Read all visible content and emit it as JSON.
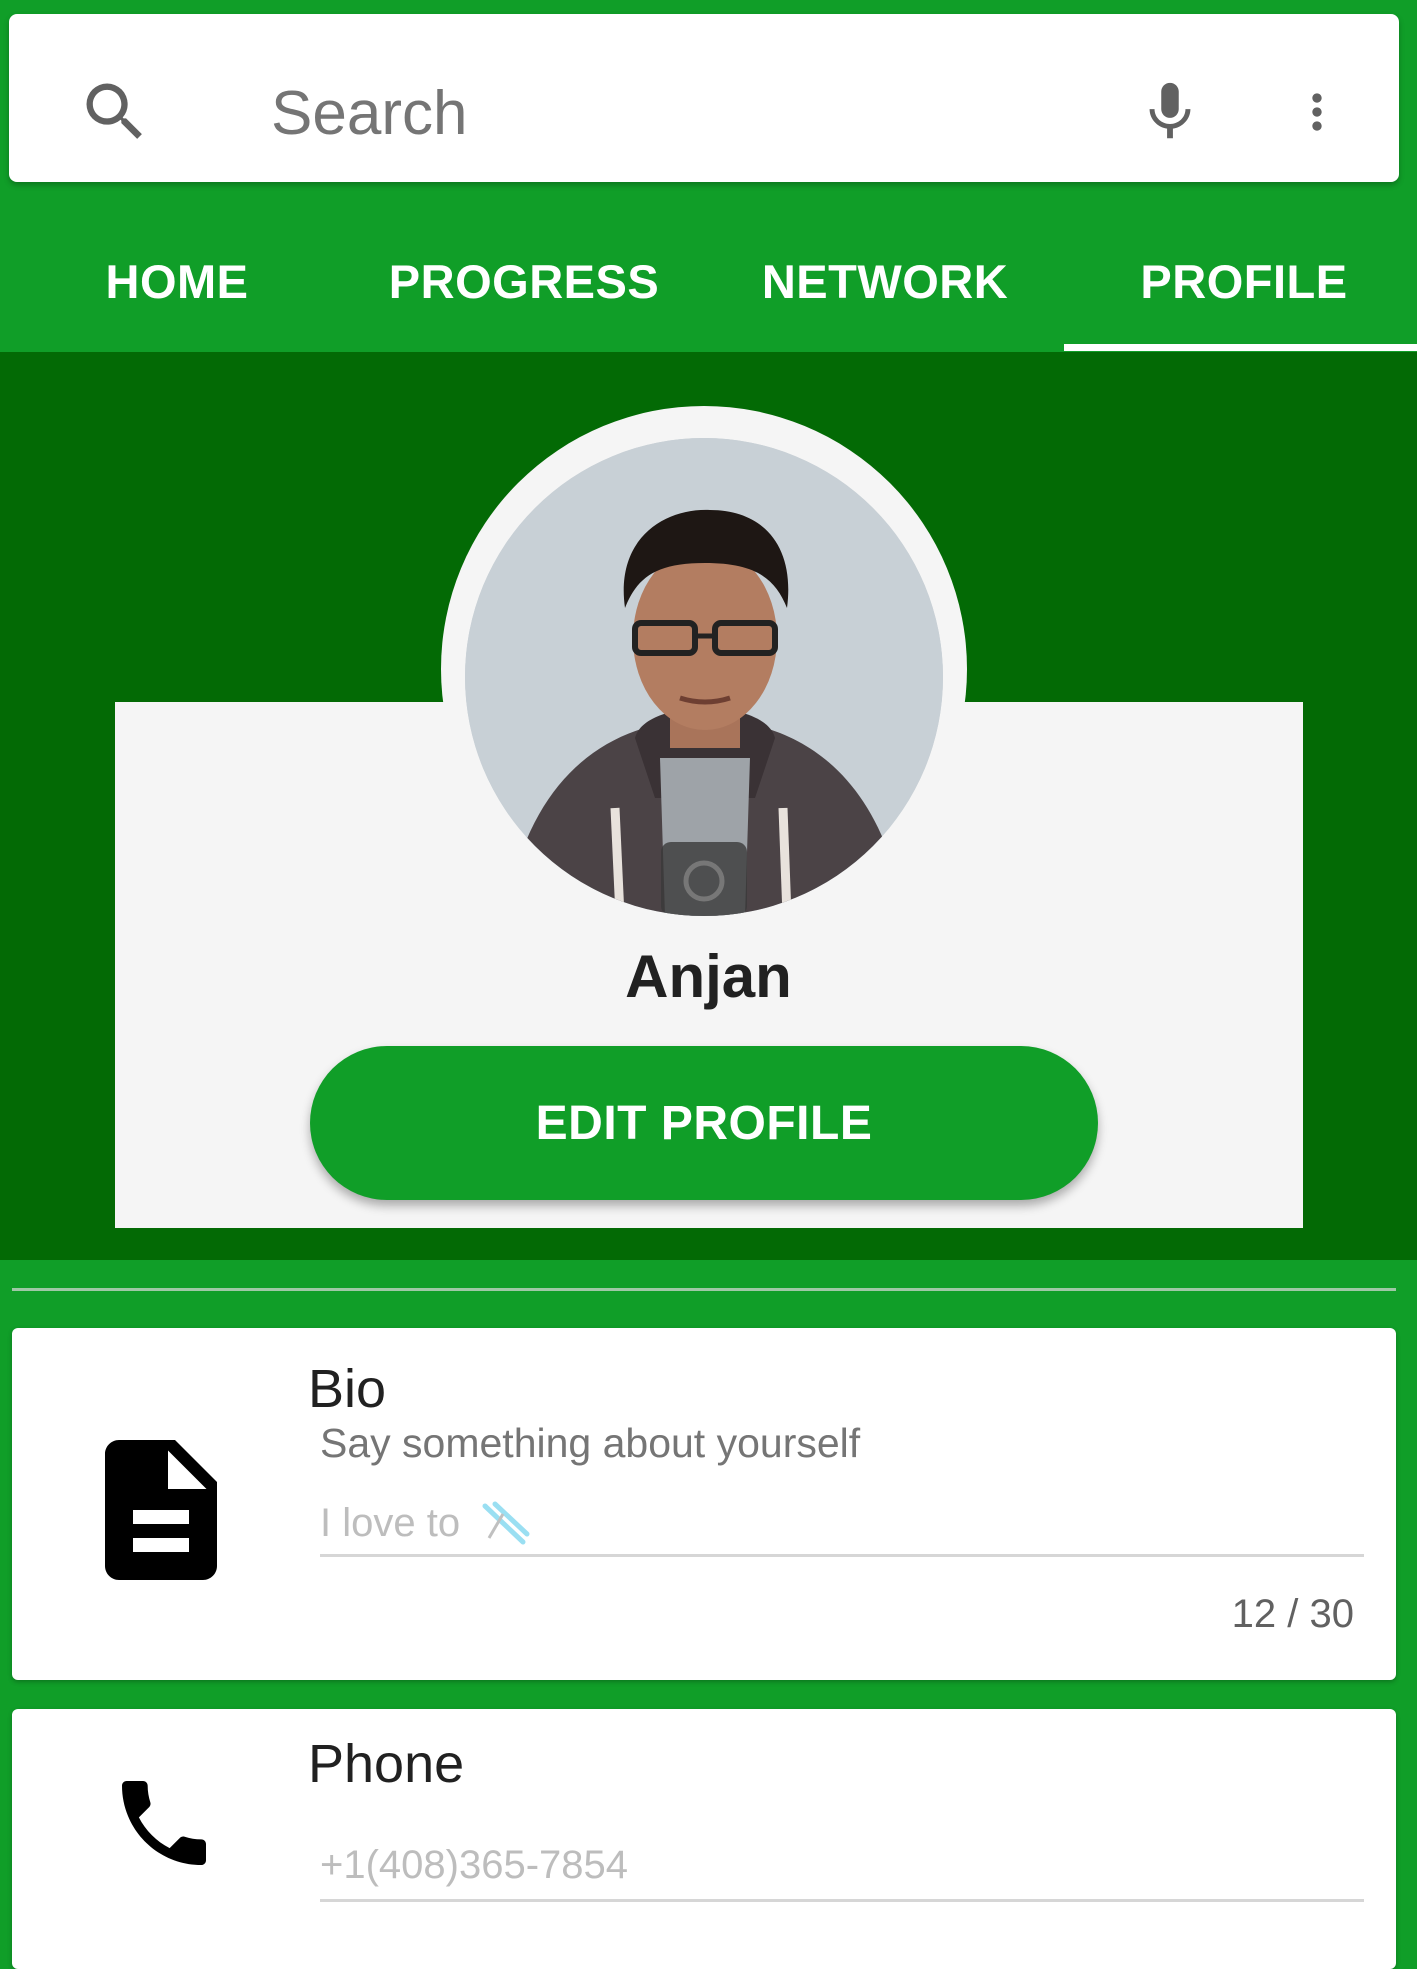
{
  "search": {
    "placeholder": "Search",
    "icons": [
      "search-icon",
      "mic-icon",
      "more-vert-icon"
    ]
  },
  "tabs": [
    {
      "label": "HOME",
      "active": false
    },
    {
      "label": "PROGRESS",
      "active": false
    },
    {
      "label": "NETWORK",
      "active": false
    },
    {
      "label": "PROFILE",
      "active": true
    }
  ],
  "profile": {
    "name": "Anjan",
    "edit_button": "EDIT PROFILE",
    "avatar_icon": "person-photo"
  },
  "fields": {
    "bio": {
      "icon": "description-icon",
      "title": "Bio",
      "hint": "Say something about yourself",
      "value": "I love to",
      "emoji": "ski-emoji",
      "counter": "12 / 30"
    },
    "phone": {
      "icon": "phone-icon",
      "title": "Phone",
      "value": "+1(408)365-7854"
    }
  },
  "colors": {
    "primary": "#109e28",
    "dark": "#036a05",
    "card": "#f5f5f5",
    "text": "#212121"
  }
}
